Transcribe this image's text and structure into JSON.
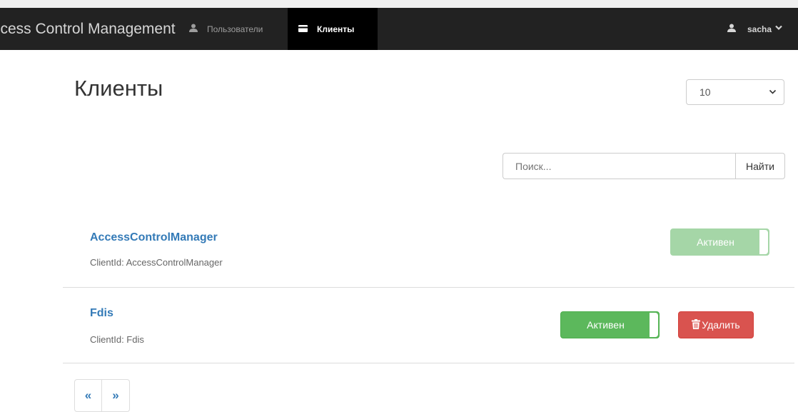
{
  "navbar": {
    "brand": "ccess Control Management",
    "users_label": "Пользователи",
    "clients_label": "Клиенты",
    "username": "sacha",
    "caret": "❯"
  },
  "page": {
    "title": "Клиенты",
    "page_size": "10"
  },
  "search": {
    "placeholder": "Поиск...",
    "button_label": "Найти"
  },
  "clients": [
    {
      "name": "AccessControlManager",
      "client_id": "ClientId: AccessControlManager",
      "status": "Активен"
    },
    {
      "name": "Fdis",
      "client_id": "ClientId: Fdis",
      "status": "Активен",
      "delete_label": "Удалить"
    }
  ],
  "pager": {
    "prev": "«",
    "next": "»"
  },
  "colors": {
    "navbar_bg": "#222222",
    "active_nav_bg": "#000000",
    "link": "#337ab7",
    "success": "#5cb85c",
    "success_faded": "#a5d6a7",
    "danger": "#d9534f"
  },
  "icons": {
    "users": "user-icon",
    "clients": "credit-card-icon",
    "account": "user-icon",
    "delete": "trash-icon"
  }
}
